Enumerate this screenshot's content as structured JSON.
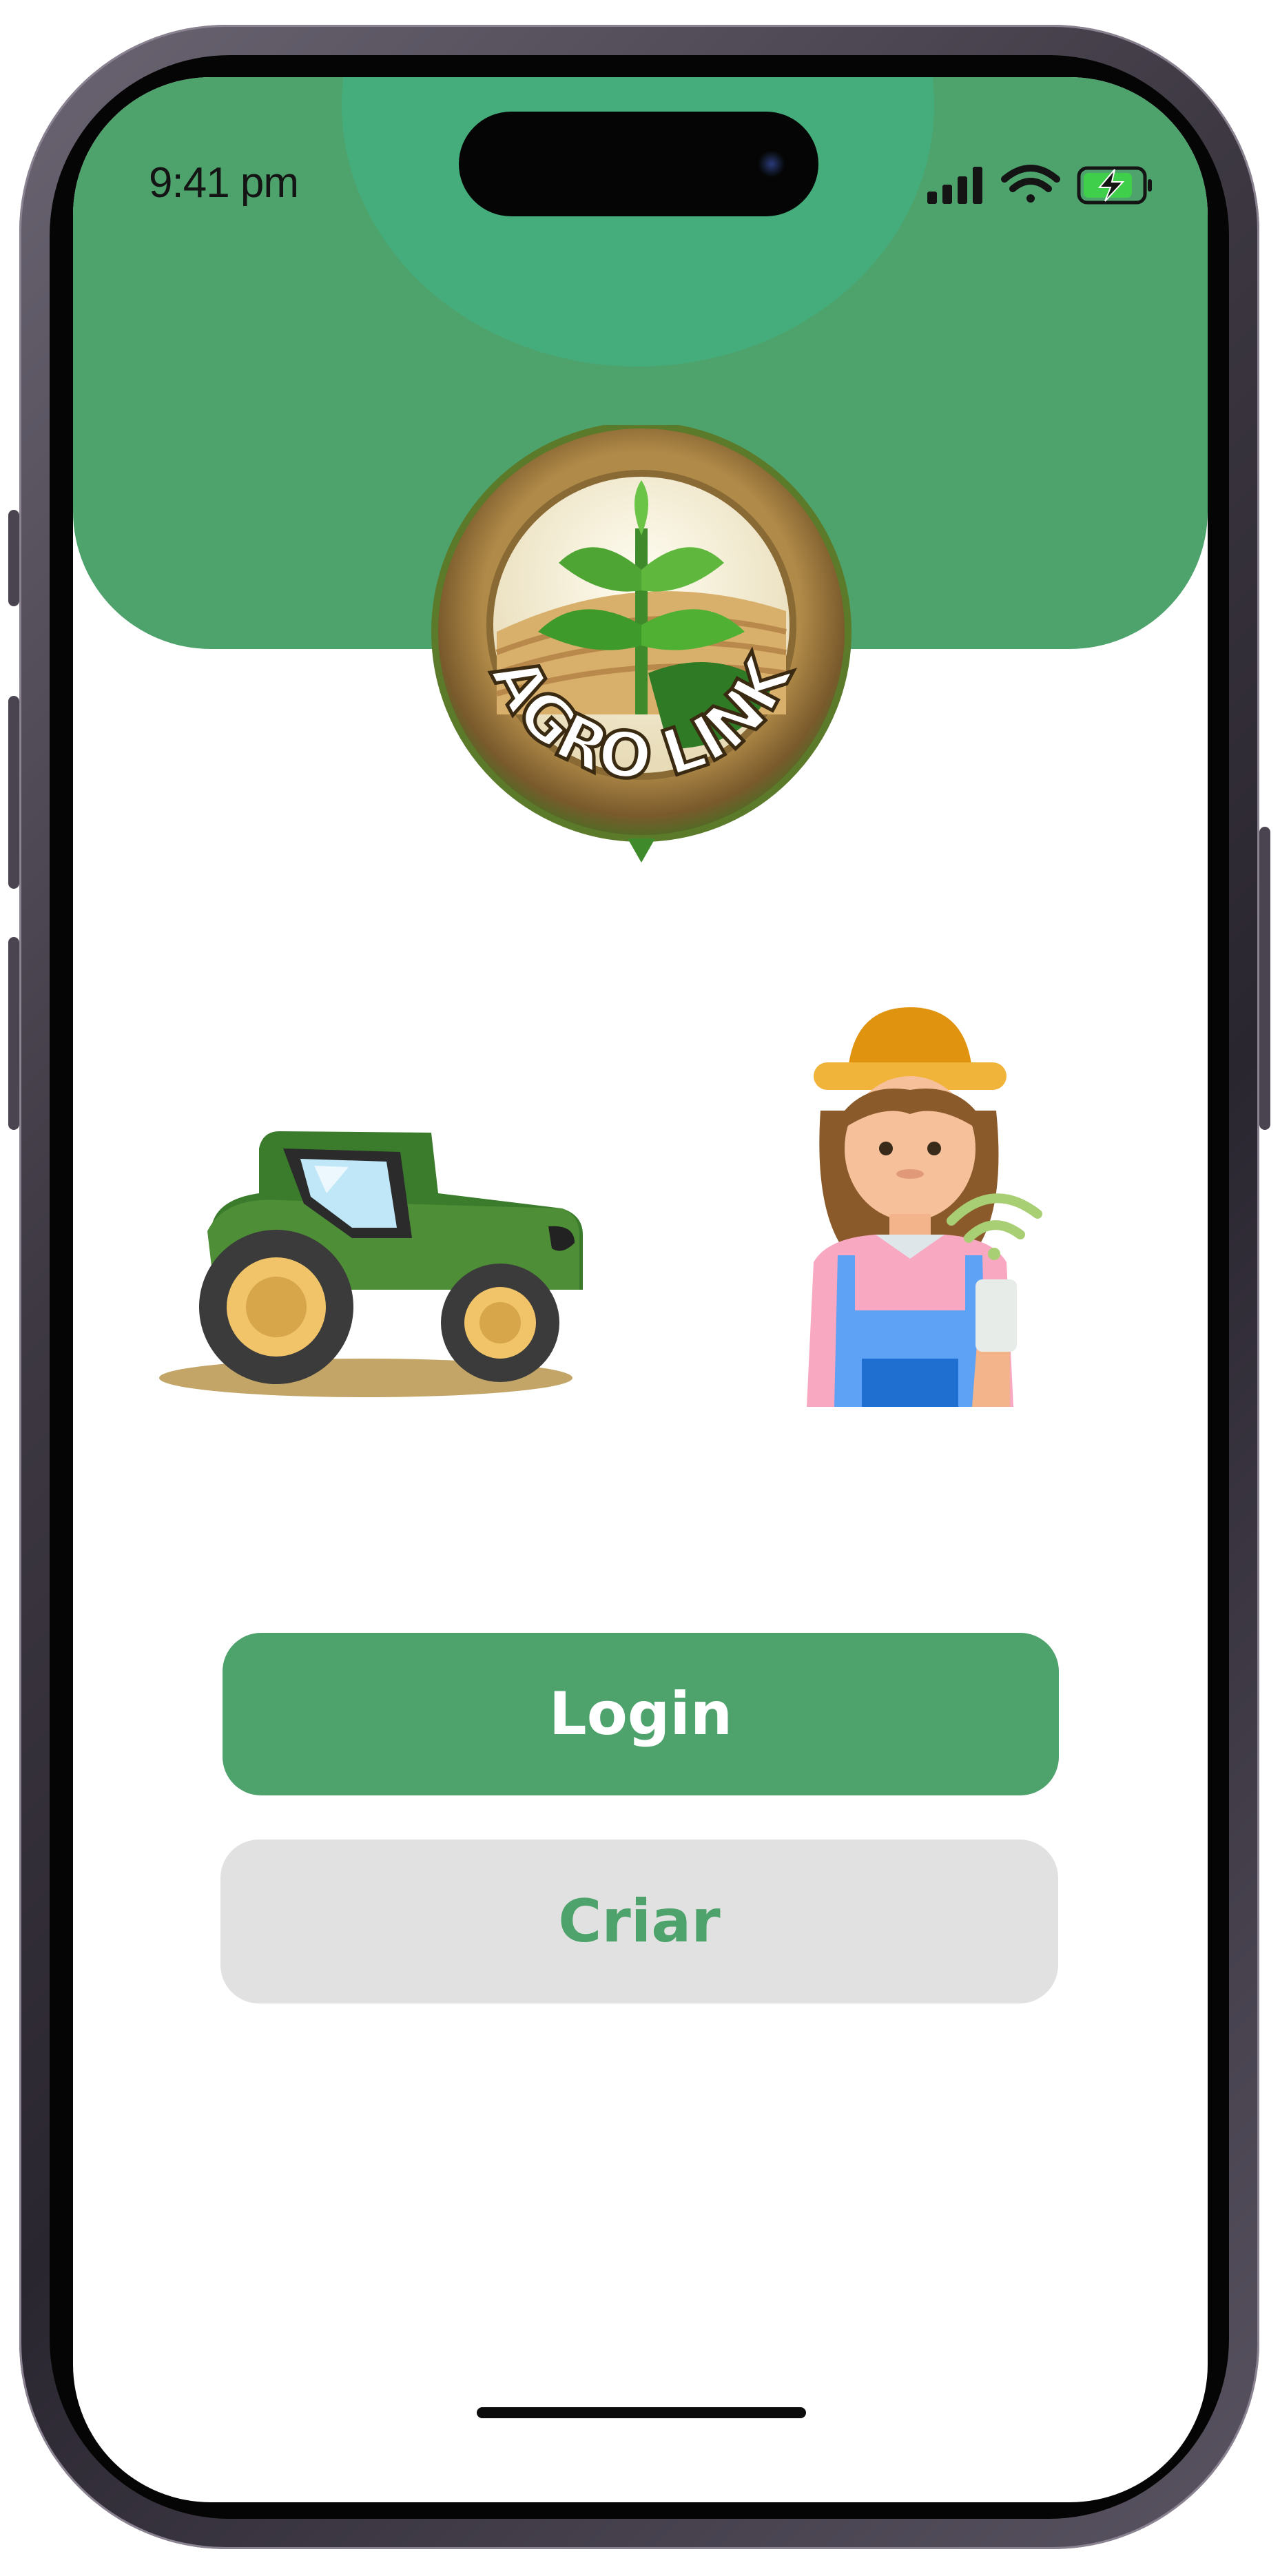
{
  "status_bar": {
    "time": "9:41 pm",
    "signal_icon": "cellular-signal-icon",
    "wifi_icon": "wifi-icon",
    "battery_icon": "battery-charging-icon"
  },
  "logo": {
    "text": "AGRO LINK"
  },
  "illustrations": {
    "left": "tractor-illustration",
    "right": "farmer-woman-illustration"
  },
  "actions": {
    "login_label": "Login",
    "create_label": "Criar"
  },
  "colors": {
    "brand_green": "#4ea36c",
    "header_accent": "#45ac7b",
    "secondary_button": "#e1e1e1"
  }
}
